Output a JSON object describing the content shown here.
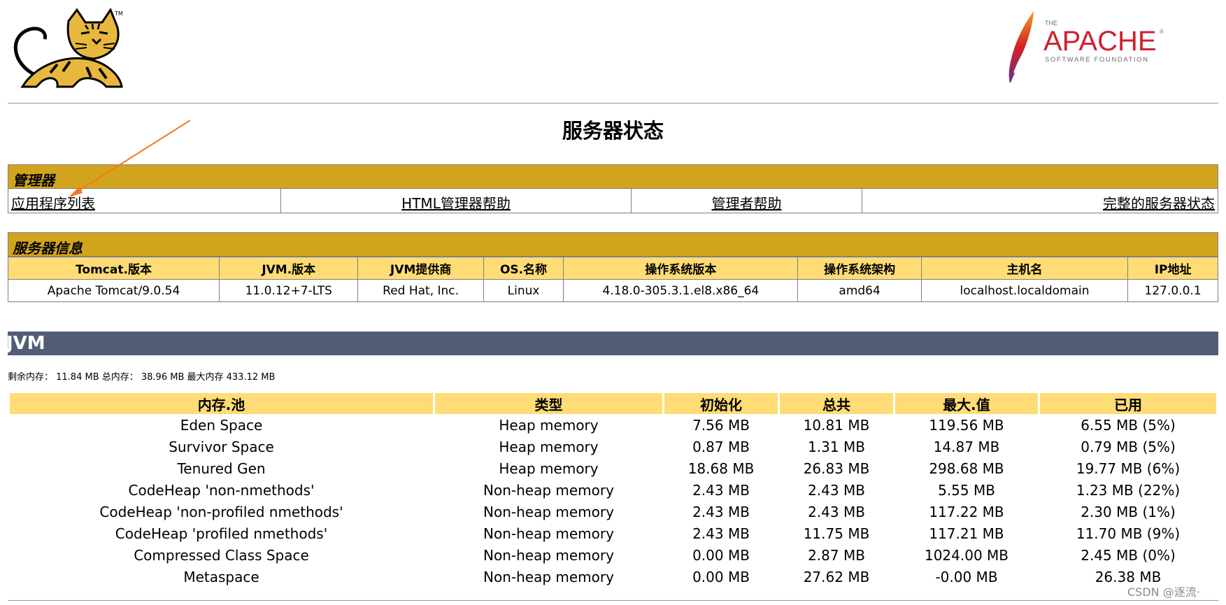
{
  "page_title": "服务器状态",
  "manager": {
    "section_title": "管理器",
    "links": [
      "应用程序列表",
      "HTML管理器帮助",
      "管理者帮助",
      "完整的服务器状态"
    ]
  },
  "server_info": {
    "section_title": "服务器信息",
    "headers": [
      "Tomcat.版本",
      "JVM.版本",
      "JVM提供商",
      "OS.名称",
      "操作系统版本",
      "操作系统架构",
      "主机名",
      "IP地址"
    ],
    "values": [
      "Apache Tomcat/9.0.54",
      "11.0.12+7-LTS",
      "Red Hat, Inc.",
      "Linux",
      "4.18.0-305.3.1.el8.x86_64",
      "amd64",
      "localhost.localdomain",
      "127.0.0.1"
    ]
  },
  "jvm": {
    "title": "JVM",
    "memory_line": "剩余内存： 11.84 MB 总内存： 38.96 MB 最大内存 433.12 MB"
  },
  "pools": {
    "headers": [
      "内存.池",
      "类型",
      "初始化",
      "总共",
      "最大.值",
      "已用"
    ],
    "rows": [
      [
        "Eden Space",
        "Heap memory",
        "7.56 MB",
        "10.81 MB",
        "119.56 MB",
        "6.55 MB (5%)"
      ],
      [
        "Survivor Space",
        "Heap memory",
        "0.87 MB",
        "1.31 MB",
        "14.87 MB",
        "0.79 MB (5%)"
      ],
      [
        "Tenured Gen",
        "Heap memory",
        "18.68 MB",
        "26.83 MB",
        "298.68 MB",
        "19.77 MB (6%)"
      ],
      [
        "CodeHeap 'non-nmethods'",
        "Non-heap memory",
        "2.43 MB",
        "2.43 MB",
        "5.55 MB",
        "1.23 MB (22%)"
      ],
      [
        "CodeHeap 'non-profiled nmethods'",
        "Non-heap memory",
        "2.43 MB",
        "2.43 MB",
        "117.22 MB",
        "2.30 MB (1%)"
      ],
      [
        "CodeHeap 'profiled nmethods'",
        "Non-heap memory",
        "2.43 MB",
        "11.75 MB",
        "117.21 MB",
        "11.70 MB (9%)"
      ],
      [
        "Compressed Class Space",
        "Non-heap memory",
        "0.00 MB",
        "2.87 MB",
        "1024.00 MB",
        "2.45 MB (0%)"
      ],
      [
        "Metaspace",
        "Non-heap memory",
        "0.00 MB",
        "27.62 MB",
        "-0.00 MB",
        "26.38 MB"
      ]
    ]
  },
  "logos": {
    "tomcat_tm": "TM",
    "apache_the": "THE",
    "apache_name": "APACHE",
    "apache_sub": "SOFTWARE FOUNDATION",
    "apache_reg": "®"
  },
  "watermark": "CSDN @逐流·",
  "colors": {
    "section_header": "#D2A41C",
    "table_header": "#FFDC75",
    "jvm_bar": "#525D76",
    "annotation_arrow": "#F47920"
  }
}
